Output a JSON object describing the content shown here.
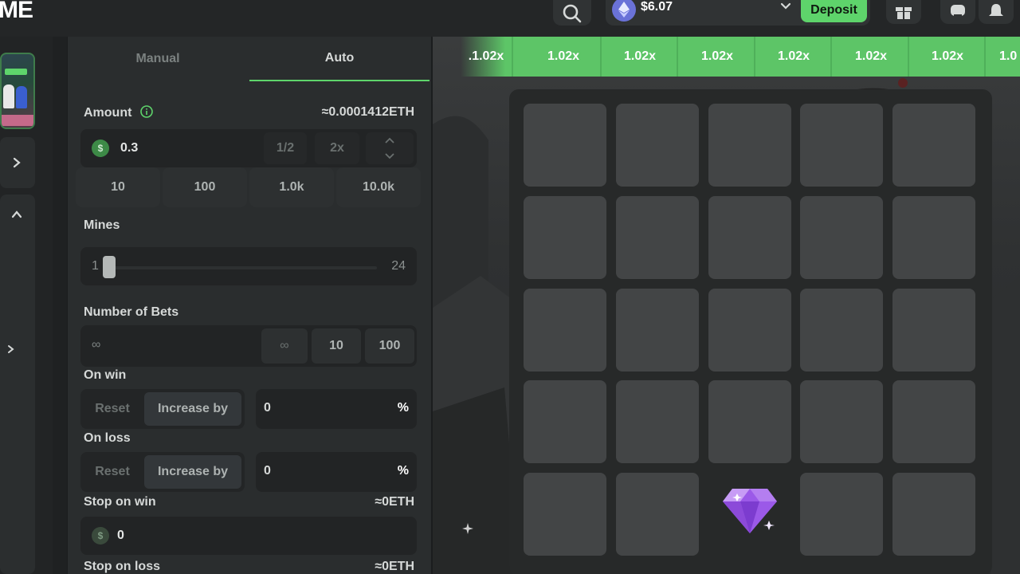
{
  "header": {
    "logo": "ME",
    "balance": "$6.07",
    "deposit_label": "Deposit"
  },
  "panel": {
    "tabs": [
      {
        "label": "Manual",
        "active": false
      },
      {
        "label": "Auto",
        "active": true
      }
    ],
    "amount": {
      "label": "Amount",
      "eth_equivalent": "≈0.0001412ETH",
      "currency_symbol": "$",
      "value": "0.3",
      "half_label": "1/2",
      "double_label": "2x",
      "quick_values": [
        "10",
        "100",
        "1.0k",
        "10.0k"
      ]
    },
    "mines": {
      "label": "Mines",
      "min": "1",
      "max": "24",
      "value": 1
    },
    "number_of_bets": {
      "label": "Number of Bets",
      "value_placeholder": "∞",
      "options": [
        "∞",
        "10",
        "100"
      ]
    },
    "on_win": {
      "label": "On win",
      "reset_label": "Reset",
      "increase_label": "Increase by",
      "value": "0",
      "unit": "%"
    },
    "on_loss": {
      "label": "On loss",
      "reset_label": "Reset",
      "increase_label": "Increase by",
      "value": "0",
      "unit": "%"
    },
    "stop_on_win": {
      "label": "Stop on win",
      "eth_equivalent": "≈0ETH",
      "currency_symbol": "$",
      "value": "0"
    },
    "stop_on_loss": {
      "label": "Stop on loss",
      "eth_equivalent": "≈0ETH"
    }
  },
  "game": {
    "multipliers": [
      ".1.02x",
      "1.02x",
      "1.02x",
      "1.02x",
      "1.02x",
      "1.02x",
      "1.02x",
      "1.0"
    ],
    "grid": {
      "rows": 5,
      "cols": 5,
      "revealed_gem_tile": {
        "row": 5,
        "col": 3
      }
    }
  },
  "colors": {
    "accent_green": "#5ed46b",
    "multiplier_strip": "#5dc567",
    "tile": "#434546",
    "panel": "#2a2d2e",
    "gem_purple": "#9b59e8"
  },
  "icons": [
    "search-icon",
    "ethereum-icon",
    "chevron-down-icon",
    "gift-icon",
    "chat-icon",
    "bell-icon",
    "info-icon",
    "dollar-coin-icon",
    "chevron-right-icon",
    "chevron-up-icon",
    "diamond-gem-icon"
  ]
}
